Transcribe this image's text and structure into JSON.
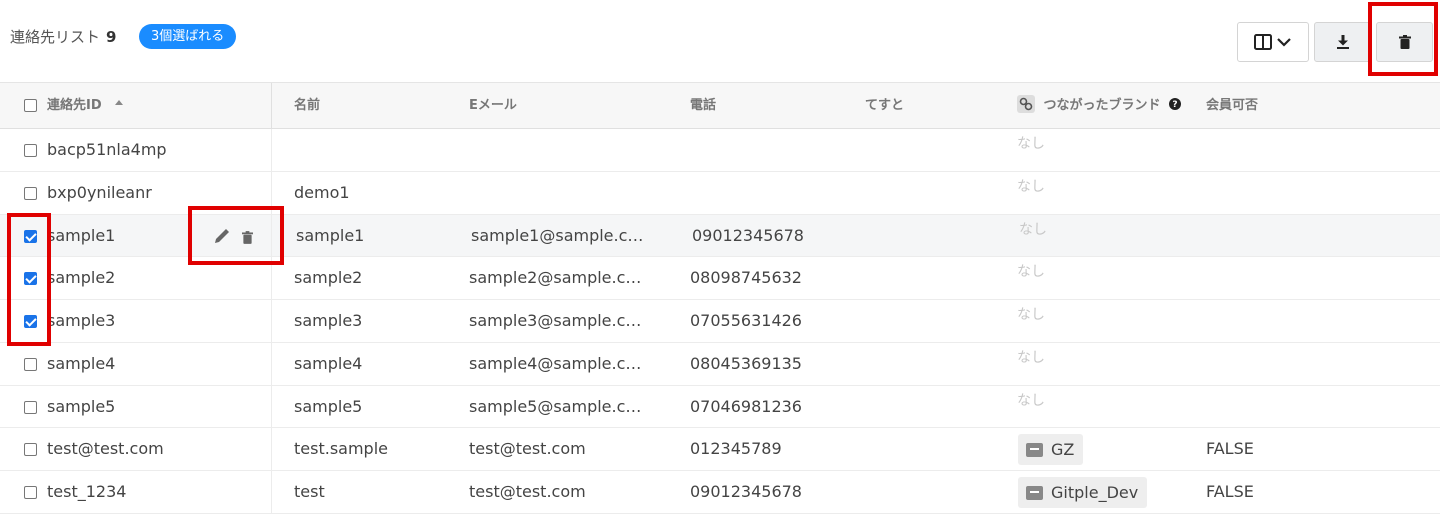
{
  "header": {
    "title": "連絡先リスト",
    "count": "9",
    "selected_badge": "3個選ばれる"
  },
  "toolbar": {
    "columns_icon": "columns-icon",
    "download_icon": "download-icon",
    "delete_icon": "trash-icon"
  },
  "columns": {
    "id": "連絡先ID",
    "name": "名前",
    "email": "Eメール",
    "phone": "電話",
    "test": "てすと",
    "brand": "つながったブランド",
    "member": "会員可否"
  },
  "rows": [
    {
      "id": "bacp51nla4mp",
      "name": "",
      "email": "",
      "phone": "",
      "brand": "なし",
      "member": "",
      "checked": false
    },
    {
      "id": "bxp0ynileanr",
      "name": "demo1",
      "email": "",
      "phone": "",
      "brand": "なし",
      "member": "",
      "checked": false
    },
    {
      "id": "sample1",
      "name": "sample1",
      "email": "sample1@sample.c…",
      "phone": "09012345678",
      "brand": "なし",
      "member": "",
      "checked": true
    },
    {
      "id": "sample2",
      "name": "sample2",
      "email": "sample2@sample.c…",
      "phone": "08098745632",
      "brand": "なし",
      "member": "",
      "checked": true
    },
    {
      "id": "sample3",
      "name": "sample3",
      "email": "sample3@sample.c…",
      "phone": "07055631426",
      "brand": "なし",
      "member": "",
      "checked": true
    },
    {
      "id": "sample4",
      "name": "sample4",
      "email": "sample4@sample.c…",
      "phone": "08045369135",
      "brand": "なし",
      "member": "",
      "checked": false
    },
    {
      "id": "sample5",
      "name": "sample5",
      "email": "sample5@sample.c…",
      "phone": "07046981236",
      "brand": "なし",
      "member": "",
      "checked": false
    },
    {
      "id": "test@test.com",
      "name": "test.sample",
      "email": "test@test.com",
      "phone": "012345789",
      "brand": "GZ",
      "member": "FALSE",
      "checked": false
    },
    {
      "id": "test_1234",
      "name": "test",
      "email": "test@test.com",
      "phone": "09012345678",
      "brand": "Gitple_Dev",
      "member": "FALSE",
      "checked": false
    }
  ],
  "colors": {
    "accent": "#1a8cff",
    "highlight": "#e00000",
    "checkbox_checked": "#1a73e8"
  }
}
